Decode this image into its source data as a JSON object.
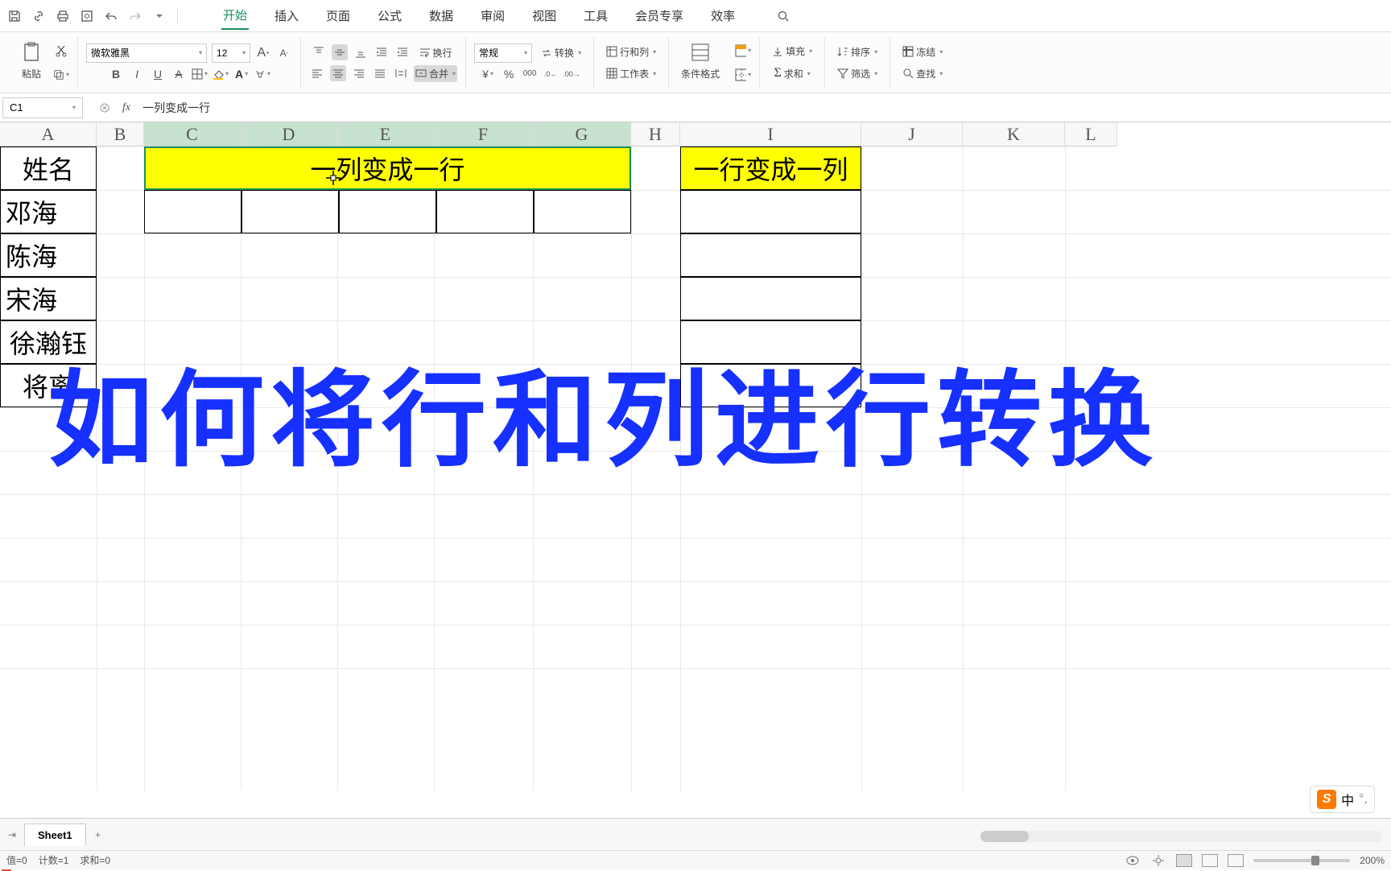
{
  "qat_icons": [
    "save",
    "link",
    "print",
    "preview",
    "undo",
    "redo"
  ],
  "menu": {
    "items": [
      "开始",
      "插入",
      "页面",
      "公式",
      "数据",
      "审阅",
      "视图",
      "工具",
      "会员专享",
      "效率"
    ],
    "active_index": 0
  },
  "ribbon": {
    "paste_label": "粘贴",
    "font_name": "微软雅黑",
    "font_size": "12",
    "increase_font": "A",
    "decrease_font": "A",
    "bold": "B",
    "italic": "I",
    "underline": "U",
    "strike": "A",
    "wrap_label": "换行",
    "merge_label": "合并",
    "number_format": "常规",
    "convert_label": "转换",
    "row_col_label": "行和列",
    "worksheet_label": "工作表",
    "cond_format_label": "条件格式",
    "fill_label": "填充",
    "sort_label": "排序",
    "freeze_label": "冻结",
    "sum_label": "求和",
    "filter_label": "筛选",
    "find_label": "查找"
  },
  "formula_bar": {
    "cell_ref": "C1",
    "fx": "fx",
    "content": "一列变成一行"
  },
  "columns": [
    "A",
    "B",
    "C",
    "D",
    "E",
    "F",
    "G",
    "H",
    "I",
    "J",
    "K",
    "L"
  ],
  "selected_columns": [
    "C",
    "D",
    "E",
    "F",
    "G"
  ],
  "cells": {
    "a1": "姓名",
    "a2": "邓海",
    "a3": "陈海",
    "a4": "宋海",
    "a5": "徐瀚钰",
    "a6": "将离",
    "c1_merged": "一列变成一行",
    "i1": "一行变成一列"
  },
  "overlay_text": "如何将行和列进行转换",
  "sheet_tabs": {
    "active": "Sheet1"
  },
  "status": {
    "left1": "值=0",
    "left2": "计数=1",
    "left3": "求和=0",
    "zoom": "200%"
  },
  "ime": {
    "logo": "S",
    "lang": "中"
  }
}
